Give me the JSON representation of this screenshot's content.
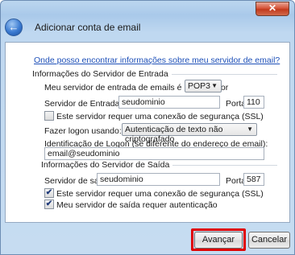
{
  "window": {
    "title": "Adicionar conta de email",
    "close_glyph": "✕",
    "back_glyph": "←",
    "back_icon": "back-arrow-icon",
    "close_icon": "close-icon"
  },
  "help_link": "Onde posso encontrar informações sobre meu servidor de email?",
  "incoming": {
    "heading": "Informações do Servidor de Entrada",
    "server_type_label": "Meu servidor de entrada de emails é um servidor",
    "server_type_value": "POP3",
    "server_label": "Servidor de Entrada:",
    "server_value": "seudominio",
    "port_label": "Porta:",
    "port_value": "110",
    "ssl_label": "Este servidor requer uma conexão de segurança (SSL)",
    "ssl_checked": false,
    "logon_label": "Fazer logon usando:",
    "logon_value": "Autenticação de texto não criptografado",
    "login_id_label": "Identificação de Logon (se diferente do endereço de email):",
    "login_id_value": "email@seudominio"
  },
  "outgoing": {
    "heading": "Informações do Servidor de Saída",
    "server_label": "Servidor de saída:",
    "server_value": "seudominio",
    "port_label": "Porta:",
    "port_value": "587",
    "ssl_label": "Este servidor requer uma conexão de segurança (SSL)",
    "ssl_checked": true,
    "auth_label": "Meu servidor de saída requer autenticação",
    "auth_checked": true
  },
  "buttons": {
    "next": "Avançar",
    "cancel": "Cancelar"
  },
  "check_glyph": "✔",
  "dropdown_glyph": "▼",
  "highlight_color": "#e00000"
}
